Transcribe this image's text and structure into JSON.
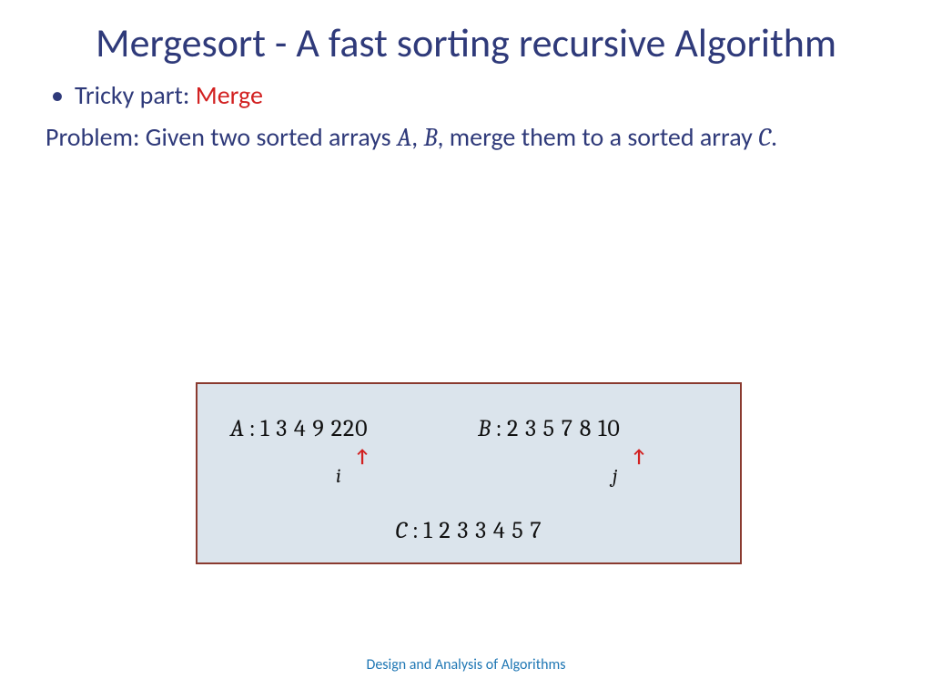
{
  "title": "Mergesort - A fast sorting recursive Algorithm",
  "bullet": {
    "prefix": "Tricky part: ",
    "highlight": "Merge"
  },
  "problem": {
    "p1": "Problem: Given two sorted arrays ",
    "A": "A",
    "comma": ", ",
    "B": "B",
    "p2": ", merge them to a sorted array ",
    "C": "C",
    "end": "."
  },
  "arrays": {
    "A_label": "A",
    "A_values": "1 3 4 9 220",
    "B_label": "B",
    "B_values": "2 3 5 7 8 10",
    "C_label": "C",
    "C_values": "1 2 3 3 4 5 7",
    "i": "i",
    "j": "j",
    "sep": " : "
  },
  "footer": "Design and Analysis of Algorithms"
}
